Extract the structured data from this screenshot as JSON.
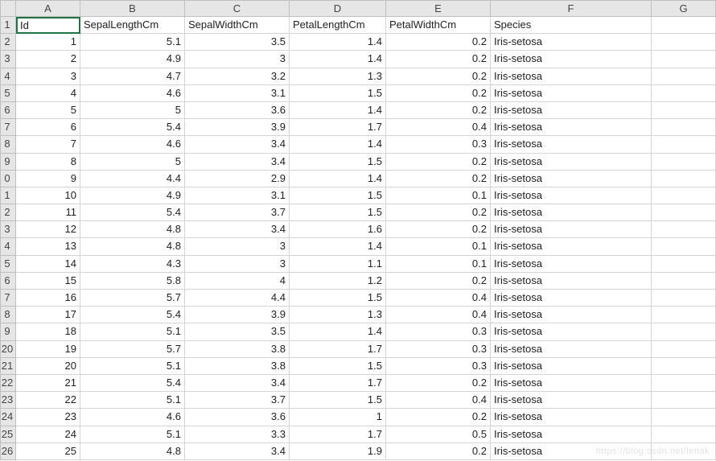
{
  "columns": [
    "A",
    "B",
    "C",
    "D",
    "E",
    "F",
    "G"
  ],
  "rowNumbers": [
    "1",
    "2",
    "3",
    "4",
    "5",
    "6",
    "7",
    "8",
    "9",
    "0",
    "1",
    "2",
    "3",
    "4",
    "5",
    "6",
    "7",
    "8",
    "9",
    "20",
    "21",
    "22",
    "23",
    "24",
    "25",
    "26"
  ],
  "header": {
    "A": "Id",
    "B": "SepalLengthCm",
    "C": "SepalWidthCm",
    "D": "PetalLengthCm",
    "E": "PetalWidthCm",
    "F": "Species",
    "G": ""
  },
  "rows": [
    {
      "A": "1",
      "B": "5.1",
      "C": "3.5",
      "D": "1.4",
      "E": "0.2",
      "F": "Iris-setosa"
    },
    {
      "A": "2",
      "B": "4.9",
      "C": "3",
      "D": "1.4",
      "E": "0.2",
      "F": "Iris-setosa"
    },
    {
      "A": "3",
      "B": "4.7",
      "C": "3.2",
      "D": "1.3",
      "E": "0.2",
      "F": "Iris-setosa"
    },
    {
      "A": "4",
      "B": "4.6",
      "C": "3.1",
      "D": "1.5",
      "E": "0.2",
      "F": "Iris-setosa"
    },
    {
      "A": "5",
      "B": "5",
      "C": "3.6",
      "D": "1.4",
      "E": "0.2",
      "F": "Iris-setosa"
    },
    {
      "A": "6",
      "B": "5.4",
      "C": "3.9",
      "D": "1.7",
      "E": "0.4",
      "F": "Iris-setosa"
    },
    {
      "A": "7",
      "B": "4.6",
      "C": "3.4",
      "D": "1.4",
      "E": "0.3",
      "F": "Iris-setosa"
    },
    {
      "A": "8",
      "B": "5",
      "C": "3.4",
      "D": "1.5",
      "E": "0.2",
      "F": "Iris-setosa"
    },
    {
      "A": "9",
      "B": "4.4",
      "C": "2.9",
      "D": "1.4",
      "E": "0.2",
      "F": "Iris-setosa"
    },
    {
      "A": "10",
      "B": "4.9",
      "C": "3.1",
      "D": "1.5",
      "E": "0.1",
      "F": "Iris-setosa"
    },
    {
      "A": "11",
      "B": "5.4",
      "C": "3.7",
      "D": "1.5",
      "E": "0.2",
      "F": "Iris-setosa"
    },
    {
      "A": "12",
      "B": "4.8",
      "C": "3.4",
      "D": "1.6",
      "E": "0.2",
      "F": "Iris-setosa"
    },
    {
      "A": "13",
      "B": "4.8",
      "C": "3",
      "D": "1.4",
      "E": "0.1",
      "F": "Iris-setosa"
    },
    {
      "A": "14",
      "B": "4.3",
      "C": "3",
      "D": "1.1",
      "E": "0.1",
      "F": "Iris-setosa"
    },
    {
      "A": "15",
      "B": "5.8",
      "C": "4",
      "D": "1.2",
      "E": "0.2",
      "F": "Iris-setosa"
    },
    {
      "A": "16",
      "B": "5.7",
      "C": "4.4",
      "D": "1.5",
      "E": "0.4",
      "F": "Iris-setosa"
    },
    {
      "A": "17",
      "B": "5.4",
      "C": "3.9",
      "D": "1.3",
      "E": "0.4",
      "F": "Iris-setosa"
    },
    {
      "A": "18",
      "B": "5.1",
      "C": "3.5",
      "D": "1.4",
      "E": "0.3",
      "F": "Iris-setosa"
    },
    {
      "A": "19",
      "B": "5.7",
      "C": "3.8",
      "D": "1.7",
      "E": "0.3",
      "F": "Iris-setosa"
    },
    {
      "A": "20",
      "B": "5.1",
      "C": "3.8",
      "D": "1.5",
      "E": "0.3",
      "F": "Iris-setosa"
    },
    {
      "A": "21",
      "B": "5.4",
      "C": "3.4",
      "D": "1.7",
      "E": "0.2",
      "F": "Iris-setosa"
    },
    {
      "A": "22",
      "B": "5.1",
      "C": "3.7",
      "D": "1.5",
      "E": "0.4",
      "F": "Iris-setosa"
    },
    {
      "A": "23",
      "B": "4.6",
      "C": "3.6",
      "D": "1",
      "E": "0.2",
      "F": "Iris-setosa"
    },
    {
      "A": "24",
      "B": "5.1",
      "C": "3.3",
      "D": "1.7",
      "E": "0.5",
      "F": "Iris-setosa"
    },
    {
      "A": "25",
      "B": "4.8",
      "C": "3.4",
      "D": "1.9",
      "E": "0.2",
      "F": "Iris-setosa"
    }
  ],
  "activeCell": "A1",
  "watermark": "https://blog.csdn.net/lenak"
}
